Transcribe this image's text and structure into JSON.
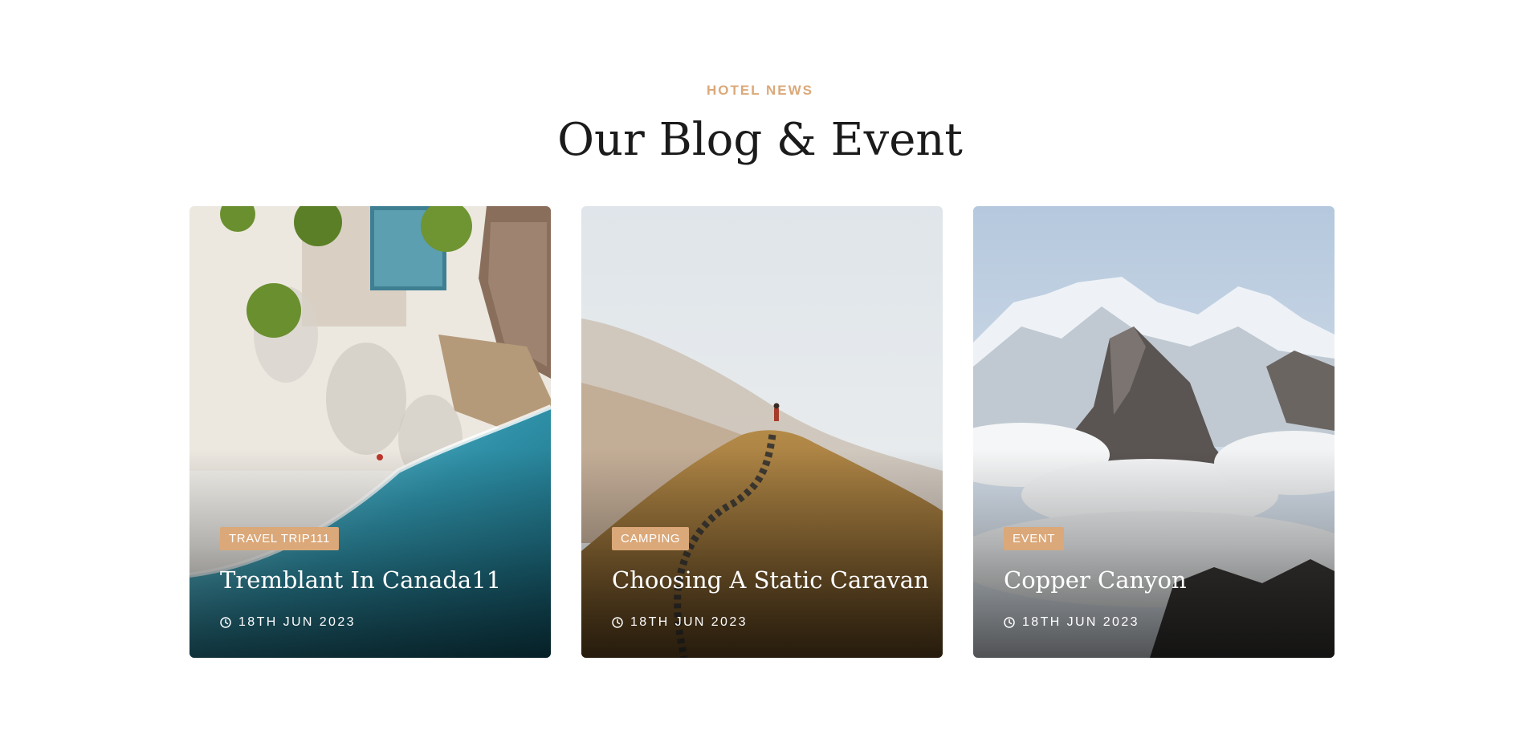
{
  "section": {
    "eyebrow": "HOTEL NEWS",
    "title": "Our Blog & Event"
  },
  "posts": [
    {
      "category": "TRAVEL TRIP111",
      "title": "Tremblant In Canada11",
      "date": "18TH JUN 2023",
      "image": "aerial-beach-resort-photo"
    },
    {
      "category": "CAMPING",
      "title": "Choosing A Static Caravan",
      "date": "18TH JUN 2023",
      "image": "foggy-hill-hiker-photo"
    },
    {
      "category": "EVENT",
      "title": "Copper Canyon",
      "date": "18TH JUN 2023",
      "image": "snowy-mountain-clouds-photo"
    }
  ],
  "colors": {
    "accent": "#dba879",
    "heading": "#1b1b1b",
    "card_text": "#ffffff"
  },
  "icons": {
    "date": "clock-icon"
  }
}
